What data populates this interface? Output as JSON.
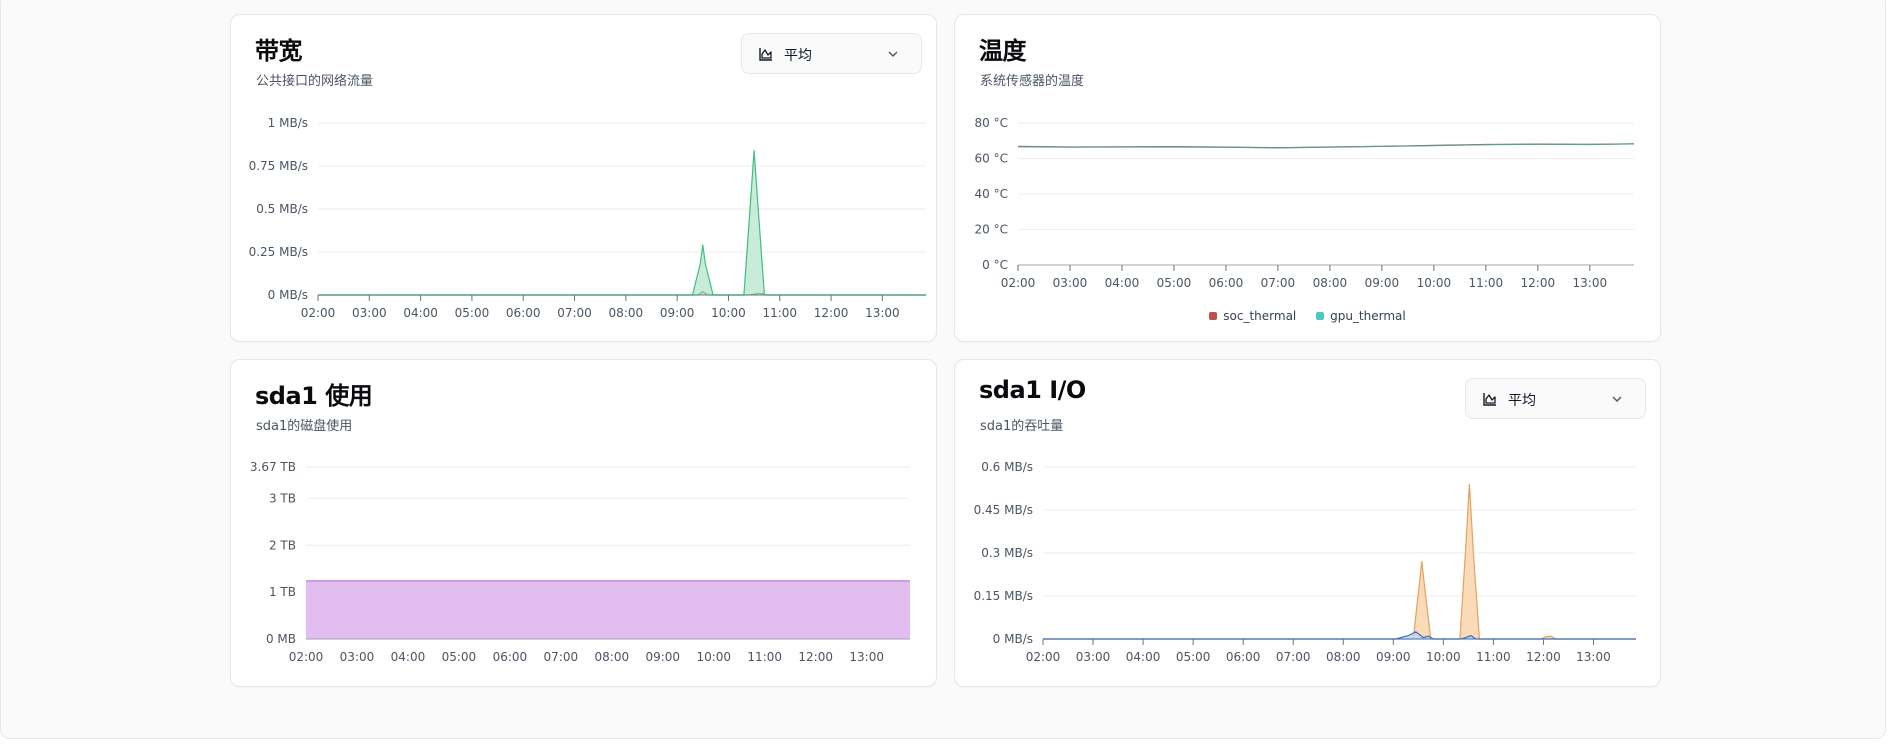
{
  "colors": {
    "bandwidth_fill": "#bfe8d2",
    "bandwidth_line": "#3fbf7f",
    "bandwidth_line2": "#9ca3af",
    "soc": "#c0504d",
    "gpu": "#4bc9c1",
    "temp_line": "#5a9e9a",
    "disk_fill": "#e2bdf0",
    "disk_line": "#b57ecf",
    "io_fill": "#f8d7b2",
    "io_line": "#e3a25d",
    "io_line2": "#3b6fb6"
  },
  "cards": {
    "bandwidth": {
      "title": "带宽",
      "subtitle": "公共接口的网络流量",
      "select": {
        "icon": "area-chart-icon",
        "value": "平均"
      }
    },
    "temperature": {
      "title": "温度",
      "subtitle": "系统传感器的温度"
    },
    "disk": {
      "title": "sda1 使用",
      "subtitle": "sda1的磁盘使用"
    },
    "io": {
      "title": "sda1 I/O",
      "subtitle": "sda1的吞吐量",
      "select": {
        "icon": "area-chart-icon",
        "value": "平均"
      }
    }
  },
  "chart_data": [
    {
      "id": "bandwidth",
      "type": "area",
      "x_ticks": [
        "02:00",
        "03:00",
        "04:00",
        "05:00",
        "06:00",
        "07:00",
        "08:00",
        "09:00",
        "10:00",
        "11:00",
        "12:00",
        "13:00"
      ],
      "y_ticks": [
        "0 MB/s",
        "0.25 MB/s",
        "0.5 MB/s",
        "0.75 MB/s",
        "1 MB/s"
      ],
      "ylim": [
        0,
        1
      ],
      "series": [
        {
          "name": "",
          "x": [
            2.0,
            9.3,
            9.45,
            9.5,
            9.55,
            9.7,
            10.3,
            10.42,
            10.5,
            10.58,
            10.7,
            13.85
          ],
          "values": [
            0,
            0,
            0.18,
            0.29,
            0.18,
            0,
            0,
            0.5,
            0.84,
            0.5,
            0,
            0
          ]
        },
        {
          "name": "",
          "x": [
            2.0,
            9.4,
            9.5,
            9.6,
            10.4,
            10.6,
            10.75,
            13.85
          ],
          "values": [
            0,
            0,
            0.02,
            0,
            0,
            0.01,
            0,
            0
          ]
        }
      ],
      "grid": true
    },
    {
      "id": "temperature",
      "type": "line",
      "x_ticks": [
        "02:00",
        "03:00",
        "04:00",
        "05:00",
        "06:00",
        "07:00",
        "08:00",
        "09:00",
        "10:00",
        "11:00",
        "12:00",
        "13:00"
      ],
      "y_ticks": [
        "0 °C",
        "20 °C",
        "40 °C",
        "60 °C",
        "80 °C"
      ],
      "ylim": [
        0,
        80
      ],
      "legend": [
        "soc_thermal",
        "gpu_thermal"
      ],
      "legend_position": "bottom-center",
      "series": [
        {
          "name": "soc_thermal",
          "x": [
            2.0,
            3.0,
            4.0,
            5.0,
            6.0,
            7.0,
            8.0,
            9.0,
            10.0,
            11.0,
            12.0,
            13.0,
            13.85
          ],
          "values": [
            66.8,
            66.5,
            66.6,
            66.7,
            66.4,
            66.1,
            66.5,
            66.9,
            67.4,
            67.9,
            68.1,
            68.0,
            68.3
          ]
        },
        {
          "name": "gpu_thermal",
          "x": [
            2.0,
            3.0,
            4.0,
            5.0,
            6.0,
            7.0,
            8.0,
            9.0,
            10.0,
            11.0,
            12.0,
            13.0,
            13.85
          ],
          "values": [
            66.6,
            66.4,
            66.5,
            66.5,
            66.3,
            66.0,
            66.4,
            66.8,
            67.2,
            67.8,
            68.0,
            67.9,
            68.2
          ]
        }
      ],
      "grid": true
    },
    {
      "id": "disk",
      "type": "area",
      "x_ticks": [
        "02:00",
        "03:00",
        "04:00",
        "05:00",
        "06:00",
        "07:00",
        "08:00",
        "09:00",
        "10:00",
        "11:00",
        "12:00",
        "13:00"
      ],
      "y_ticks": [
        "0 MB",
        "1 TB",
        "2 TB",
        "3 TB",
        "3.67 TB"
      ],
      "y_tick_values": [
        0,
        1,
        2,
        3,
        3.67
      ],
      "ylim": [
        0,
        3.67
      ],
      "series": [
        {
          "name": "",
          "x": [
            2.0,
            13.85
          ],
          "values": [
            1.24,
            1.24
          ]
        }
      ],
      "grid": true
    },
    {
      "id": "io",
      "type": "area",
      "x_ticks": [
        "02:00",
        "03:00",
        "04:00",
        "05:00",
        "06:00",
        "07:00",
        "08:00",
        "09:00",
        "10:00",
        "11:00",
        "12:00",
        "13:00"
      ],
      "y_ticks": [
        "0 MB/s",
        "0.15 MB/s",
        "0.3 MB/s",
        "0.45 MB/s",
        "0.6 MB/s"
      ],
      "ylim": [
        0,
        0.6
      ],
      "series": [
        {
          "name": "",
          "x": [
            2.0,
            9.4,
            9.5,
            9.57,
            9.64,
            9.75,
            10.33,
            10.44,
            10.52,
            10.6,
            10.72,
            11.95,
            12.05,
            12.15,
            12.25,
            13.85
          ],
          "values": [
            0,
            0,
            0.16,
            0.27,
            0.16,
            0,
            0,
            0.3,
            0.54,
            0.3,
            0,
            0,
            0.008,
            0.01,
            0,
            0
          ]
        },
        {
          "name": "",
          "x": [
            2.0,
            9.05,
            9.3,
            9.45,
            9.6,
            9.7,
            9.8,
            10.35,
            10.45,
            10.55,
            10.65,
            13.85
          ],
          "values": [
            0,
            0,
            0.012,
            0.025,
            0.005,
            0.01,
            0,
            0,
            0.005,
            0.012,
            0,
            0
          ]
        }
      ],
      "grid": true
    }
  ]
}
